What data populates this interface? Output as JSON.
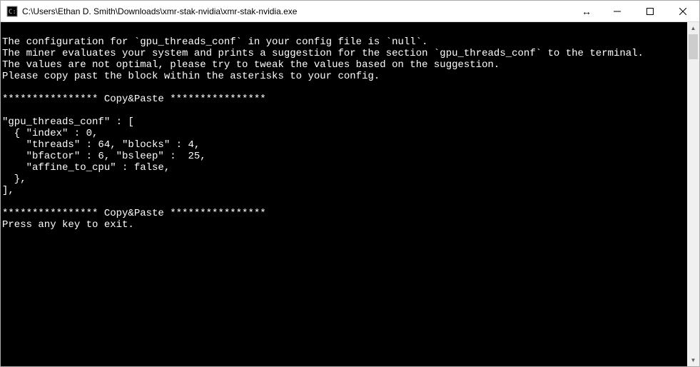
{
  "window": {
    "title": "C:\\Users\\Ethan D. Smith\\Downloads\\xmr-stak-nvidia\\xmr-stak-nvidia.exe"
  },
  "console": {
    "lines": [
      "",
      "The configuration for `gpu_threads_conf` in your config file is `null`.",
      "The miner evaluates your system and prints a suggestion for the section `gpu_threads_conf` to the terminal.",
      "The values are not optimal, please try to tweak the values based on the suggestion.",
      "Please copy past the block within the asterisks to your config.",
      "",
      "**************** Copy&Paste ****************",
      "",
      "\"gpu_threads_conf\" : [",
      "  { \"index\" : 0,",
      "    \"threads\" : 64, \"blocks\" : 4,",
      "    \"bfactor\" : 6, \"bsleep\" :  25,",
      "    \"affine_to_cpu\" : false,",
      "  },",
      "],",
      "",
      "**************** Copy&Paste ****************",
      "Press any key to exit."
    ]
  }
}
